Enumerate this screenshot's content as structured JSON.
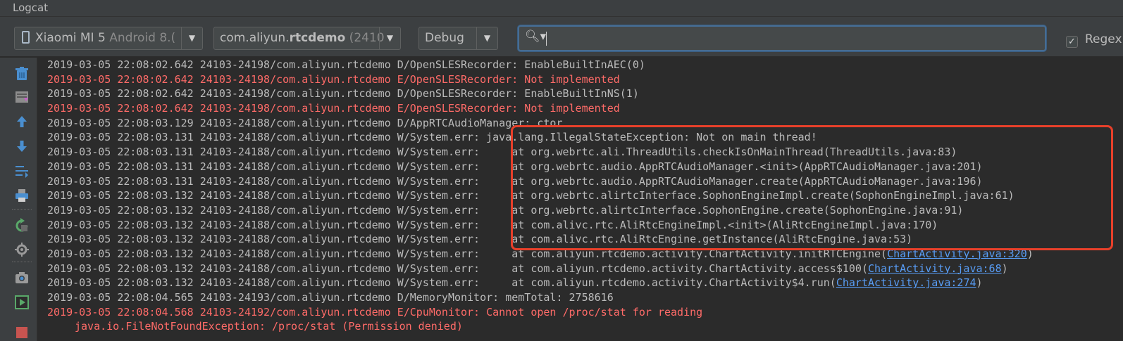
{
  "title": "Logcat",
  "toolbar": {
    "device": "Xiaomi MI 5",
    "device_os": "Android 8.(",
    "process_prefix": "com.aliyun.",
    "process_bold": "rtcdemo",
    "process_pid": " (2410",
    "level": "Debug",
    "search_value": "",
    "regex_label": "Regex",
    "regex_checked": "✓"
  },
  "sidebar": {
    "icons": [
      "trash-icon",
      "scroll-to-end-icon",
      "up-arrow-icon",
      "down-arrow-icon",
      "soft-wrap-icon",
      "print-icon",
      "restart-icon",
      "settings-icon",
      "camera-icon",
      "record-icon",
      "stop-icon"
    ]
  },
  "log": {
    "lines": [
      {
        "level": "D",
        "text": "2019-03-05 22:08:02.642 24103-24198/com.aliyun.rtcdemo D/OpenSLESRecorder: EnableBuiltInAEC(0)"
      },
      {
        "level": "E",
        "text": "2019-03-05 22:08:02.642 24103-24198/com.aliyun.rtcdemo E/OpenSLESRecorder: Not implemented"
      },
      {
        "level": "D",
        "text": "2019-03-05 22:08:02.642 24103-24198/com.aliyun.rtcdemo D/OpenSLESRecorder: EnableBuiltInNS(1)"
      },
      {
        "level": "E",
        "text": "2019-03-05 22:08:02.642 24103-24198/com.aliyun.rtcdemo E/OpenSLESRecorder: Not implemented"
      },
      {
        "level": "D",
        "text": "2019-03-05 22:08:03.129 24103-24188/com.aliyun.rtcdemo D/AppRTCAudioManager: ctor"
      },
      {
        "level": "W",
        "text": "2019-03-05 22:08:03.131 24103-24188/com.aliyun.rtcdemo W/System.err: java.lang.IllegalStateException: Not on main thread!"
      },
      {
        "level": "W",
        "text": "2019-03-05 22:08:03.131 24103-24188/com.aliyun.rtcdemo W/System.err:     at org.webrtc.ali.ThreadUtils.checkIsOnMainThread(ThreadUtils.java:83)"
      },
      {
        "level": "W",
        "text": "2019-03-05 22:08:03.131 24103-24188/com.aliyun.rtcdemo W/System.err:     at org.webrtc.audio.AppRTCAudioManager.<init>(AppRTCAudioManager.java:201)"
      },
      {
        "level": "W",
        "text": "2019-03-05 22:08:03.131 24103-24188/com.aliyun.rtcdemo W/System.err:     at org.webrtc.audio.AppRTCAudioManager.create(AppRTCAudioManager.java:196)"
      },
      {
        "level": "W",
        "text": "2019-03-05 22:08:03.132 24103-24188/com.aliyun.rtcdemo W/System.err:     at org.webrtc.alirtcInterface.SophonEngineImpl.create(SophonEngineImpl.java:61)"
      },
      {
        "level": "W",
        "text": "2019-03-05 22:08:03.132 24103-24188/com.aliyun.rtcdemo W/System.err:     at org.webrtc.alirtcInterface.SophonEngine.create(SophonEngine.java:91)"
      },
      {
        "level": "W",
        "text": "2019-03-05 22:08:03.132 24103-24188/com.aliyun.rtcdemo W/System.err:     at com.alivc.rtc.AliRtcEngineImpl.<init>(AliRtcEngineImpl.java:170)"
      },
      {
        "level": "W",
        "text": "2019-03-05 22:08:03.132 24103-24188/com.aliyun.rtcdemo W/System.err:     at com.alivc.rtc.AliRtcEngine.getInstance(AliRtcEngine.java:53)"
      },
      {
        "level": "W",
        "text": "2019-03-05 22:08:03.132 24103-24188/com.aliyun.rtcdemo W/System.err:     at com.aliyun.rtcdemo.activity.ChartActivity.initRTCEngine(",
        "link": "ChartActivity.java:320",
        "suffix": ")"
      },
      {
        "level": "W",
        "text": "2019-03-05 22:08:03.132 24103-24188/com.aliyun.rtcdemo W/System.err:     at com.aliyun.rtcdemo.activity.ChartActivity.access$100(",
        "link": "ChartActivity.java:68",
        "suffix": ")"
      },
      {
        "level": "W",
        "text": "2019-03-05 22:08:03.132 24103-24188/com.aliyun.rtcdemo W/System.err:     at com.aliyun.rtcdemo.activity.ChartActivity$4.run(",
        "link": "ChartActivity.java:274",
        "suffix": ")"
      },
      {
        "level": "D",
        "text": "2019-03-05 22:08:04.565 24103-24193/com.aliyun.rtcdemo D/MemoryMonitor: memTotal: 2758616"
      },
      {
        "level": "E",
        "text": "2019-03-05 22:08:04.568 24103-24192/com.aliyun.rtcdemo E/CpuMonitor: Cannot open /proc/stat for reading"
      },
      {
        "level": "E",
        "cont": true,
        "text": "java.io.FileNotFoundException: /proc/stat (Permission denied)"
      }
    ]
  },
  "colors": {
    "error": "#ff6b68",
    "debug": "#bbbbbb",
    "link": "#589df6",
    "highlight_border": "#e8402a"
  }
}
